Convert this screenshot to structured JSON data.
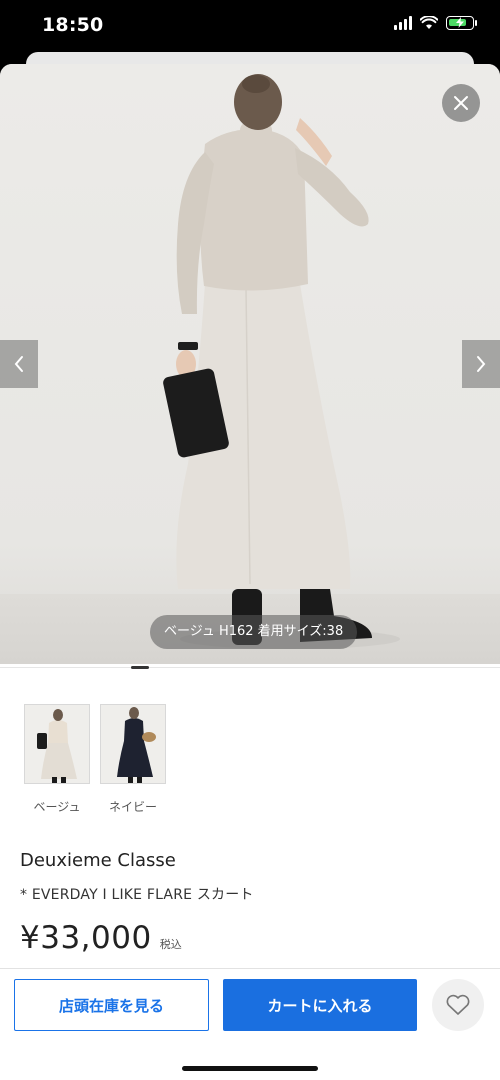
{
  "status_bar": {
    "time": "18:50",
    "battery_level": 0.8,
    "icons": [
      "signal-icon",
      "wifi-icon",
      "battery-charging-icon"
    ]
  },
  "product": {
    "photo_caption": "ベージュ H162 着用サイズ:38",
    "colors": [
      {
        "label": "ベージュ",
        "thumb_color": "#e3ddd4"
      },
      {
        "label": "ネイビー",
        "thumb_color": "#1e2230"
      }
    ],
    "brand": "Deuxieme Classe",
    "name": "* EVERDAY I LIKE FLARE スカート",
    "price": "¥33,000",
    "tax_label": "税込"
  },
  "actions": {
    "store_stock_label": "店頭在庫を見る",
    "add_to_cart_label": "カートに入れる"
  },
  "icons": {
    "close": "close-icon",
    "prev": "chevron-left-icon",
    "next": "chevron-right-icon",
    "favorite": "heart-icon"
  },
  "colors": {
    "accent": "#1a6fe0",
    "photo_background": "#ecebe8"
  }
}
